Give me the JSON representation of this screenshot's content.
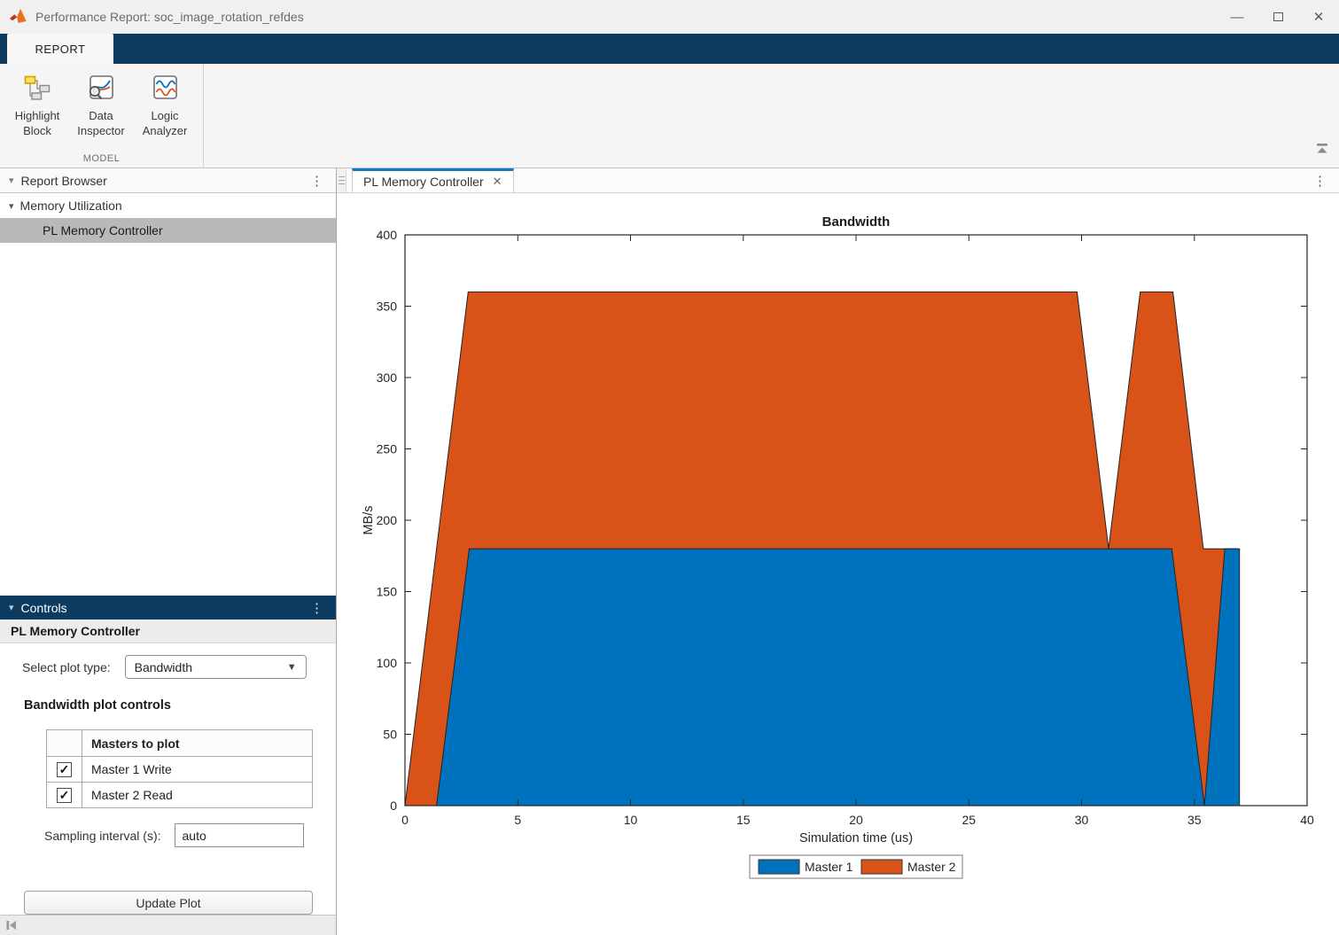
{
  "window": {
    "title": "Performance Report: soc_image_rotation_refdes"
  },
  "icons": {
    "kebab": "⋮",
    "section_collapse": "▾",
    "tree_expander": "▾",
    "dropdown_arrow": "▼",
    "tab_close": "✕",
    "minimize": "—",
    "close": "✕",
    "checked": "✓"
  },
  "ribbon": {
    "tab": "REPORT",
    "group_label": "MODEL",
    "buttons": [
      {
        "line1": "Highlight",
        "line2": "Block"
      },
      {
        "line1": "Data",
        "line2": "Inspector"
      },
      {
        "line1": "Logic",
        "line2": "Analyzer"
      }
    ]
  },
  "report_browser": {
    "title": "Report Browser",
    "tree": [
      {
        "label": "Memory Utilization"
      },
      {
        "label": "PL Memory Controller"
      }
    ]
  },
  "controls_panel": {
    "title": "Controls",
    "subtitle": "PL Memory Controller",
    "plot_type_label": "Select plot type:",
    "plot_type_value": "Bandwidth",
    "section_heading": "Bandwidth plot controls",
    "table": {
      "header": "Masters to plot",
      "rows": [
        {
          "label": "Master 1 Write",
          "checked": true
        },
        {
          "label": "Master 2 Read",
          "checked": true
        }
      ]
    },
    "sampling_label": "Sampling interval (s):",
    "sampling_value": "auto",
    "update_button": "Update Plot"
  },
  "main": {
    "tab": "PL Memory Controller"
  },
  "chart_data": {
    "type": "area",
    "title": "Bandwidth",
    "xlabel": "Simulation time (us)",
    "ylabel": "MB/s",
    "xlim": [
      0,
      40
    ],
    "ylim": [
      0,
      400
    ],
    "xticks": [
      0,
      5,
      10,
      15,
      20,
      25,
      30,
      35,
      40
    ],
    "yticks": [
      0,
      50,
      100,
      150,
      200,
      250,
      300,
      350,
      400
    ],
    "grid": false,
    "legend_position": "south-outside",
    "series": [
      {
        "name": "Master 2",
        "color": "#D95319",
        "points": [
          [
            0,
            0
          ],
          [
            2.8,
            360
          ],
          [
            29.8,
            360
          ],
          [
            31.2,
            180
          ],
          [
            32.6,
            360
          ],
          [
            34.05,
            360
          ],
          [
            35.4,
            180
          ],
          [
            36.9,
            180
          ],
          [
            36.9,
            0
          ]
        ]
      },
      {
        "name": "Master 1",
        "color": "#0072BD",
        "points": [
          [
            1.4,
            0
          ],
          [
            2.85,
            180
          ],
          [
            34.0,
            180
          ],
          [
            35.45,
            0
          ],
          [
            36.35,
            180
          ],
          [
            37.0,
            180
          ],
          [
            37.0,
            0
          ]
        ]
      }
    ],
    "legend": [
      {
        "name": "Master 1",
        "color": "#0072BD"
      },
      {
        "name": "Master 2",
        "color": "#D95319"
      }
    ]
  }
}
